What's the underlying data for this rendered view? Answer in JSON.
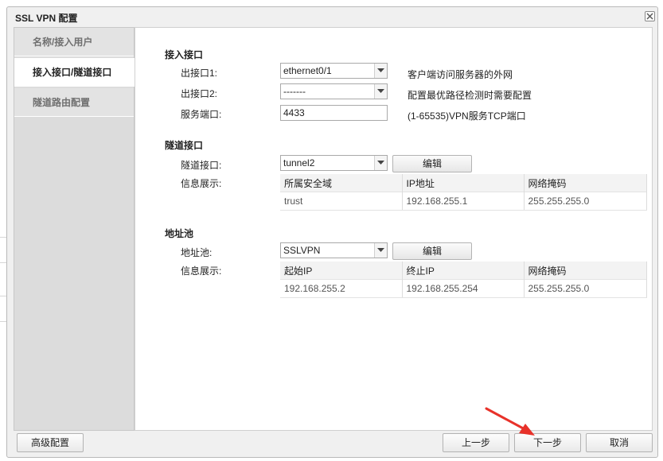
{
  "dialog": {
    "title": "SSL VPN 配置"
  },
  "sidebar": {
    "items": [
      {
        "label": "名称/接入用户",
        "active": false
      },
      {
        "label": "接入接口/隧道接口",
        "active": true
      },
      {
        "label": "隧道路由配置",
        "active": false
      }
    ]
  },
  "access": {
    "section_title": "接入接口",
    "out1": {
      "label": "出接口1:",
      "value": "ethernet0/1",
      "hint": "客户端访问服务器的外网"
    },
    "out2": {
      "label": "出接口2:",
      "value": "-------",
      "hint": "配置最优路径检测时需要配置"
    },
    "port": {
      "label": "服务端口:",
      "value": "4433",
      "hint": "(1-65535)VPN服务TCP端口"
    }
  },
  "tunnel": {
    "section_title": "隧道接口",
    "iface_label": "隧道接口:",
    "iface_value": "tunnel2",
    "edit_label": "编辑",
    "info_label": "信息展示:",
    "headers": [
      "所属安全域",
      "IP地址",
      "网络掩码"
    ],
    "rows": [
      [
        "trust",
        "192.168.255.1",
        "255.255.255.0"
      ]
    ]
  },
  "pool": {
    "section_title": "地址池",
    "pool_label": "地址池:",
    "pool_value": "SSLVPN",
    "edit_label": "编辑",
    "info_label": "信息展示:",
    "headers": [
      "起始IP",
      "终止IP",
      "网络掩码"
    ],
    "rows": [
      [
        "192.168.255.2",
        "192.168.255.254",
        "255.255.255.0"
      ]
    ]
  },
  "footer": {
    "advanced_label": "高级配置",
    "prev_label": "上一步",
    "next_label": "下一步",
    "cancel_label": "取消"
  },
  "colors": {
    "annotation_arrow": "#e8322a"
  }
}
